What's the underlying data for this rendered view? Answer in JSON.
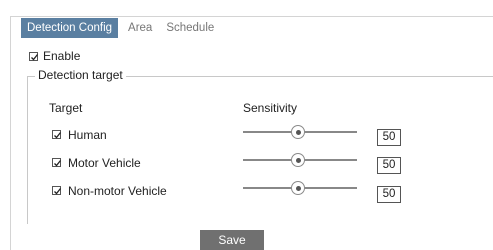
{
  "tabs": [
    "Detection Config",
    "Area",
    "Schedule"
  ],
  "enable": {
    "label": "Enable",
    "checked": true
  },
  "detection_target": {
    "legend": "Detection target",
    "columns": {
      "target": "Target",
      "sensitivity": "Sensitivity"
    },
    "rows": [
      {
        "label": "Human",
        "checked": true,
        "sensitivity": "50"
      },
      {
        "label": "Motor Vehicle",
        "checked": true,
        "sensitivity": "50"
      },
      {
        "label": "Non-motor Vehicle",
        "checked": true,
        "sensitivity": "50"
      }
    ]
  },
  "save_label": "Save"
}
